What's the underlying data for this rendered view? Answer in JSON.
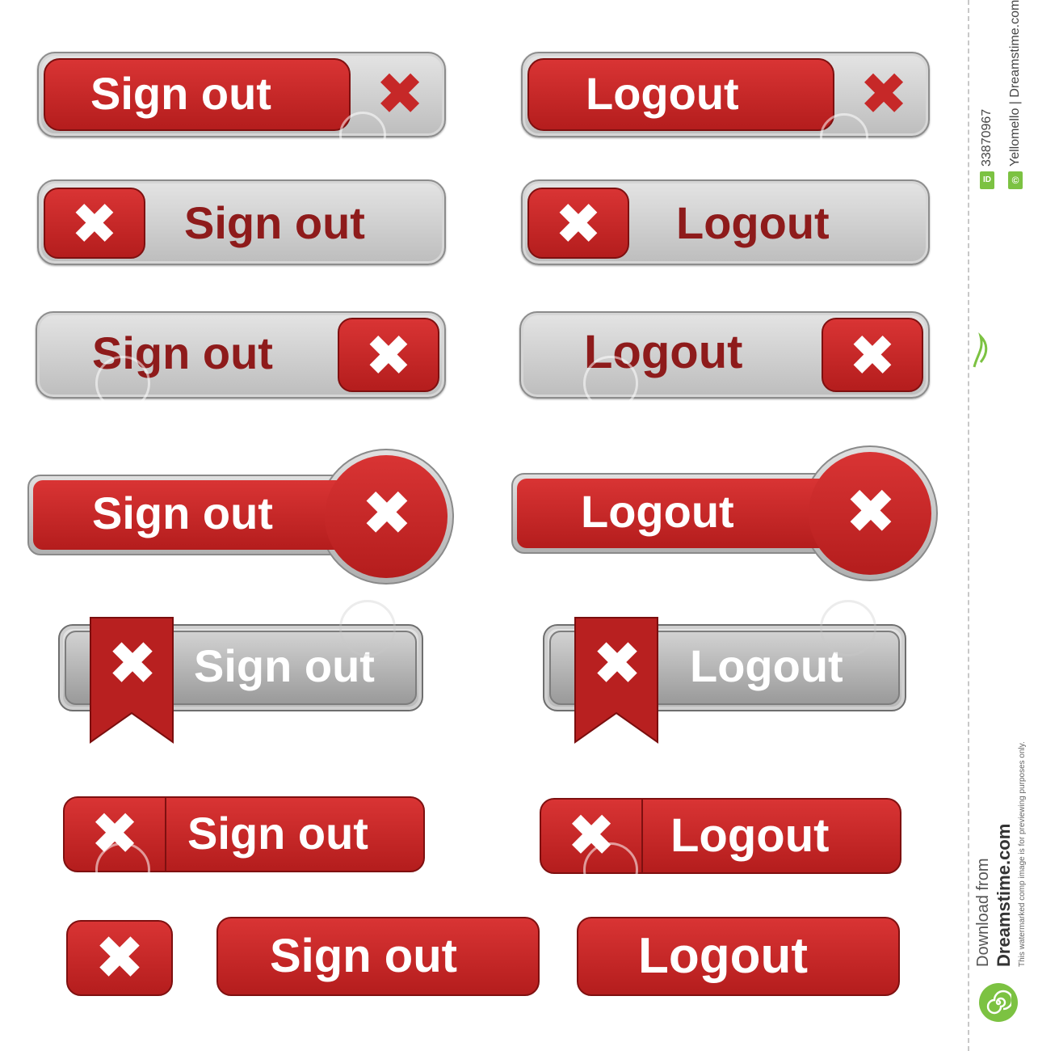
{
  "buttons": {
    "sign_out": "Sign out",
    "logout": "Logout"
  },
  "icons": {
    "close": "close-icon",
    "ribbon": "ribbon-icon",
    "watermark": "dreamstime-spiral-logo"
  },
  "colors": {
    "red": "#c62828",
    "dark_red": "#8e1b1b",
    "gray": "#c4c4c4",
    "white": "#ffffff"
  },
  "sidebar": {
    "image_id_label": "ID",
    "image_id": "33870967",
    "copyright_symbol": "©",
    "credit": "Yellomello | Dreamstime.com",
    "download_from": "Download from",
    "site": "Dreamstime.com",
    "disclaimer": "This watermarked comp image is for previewing purposes only."
  }
}
